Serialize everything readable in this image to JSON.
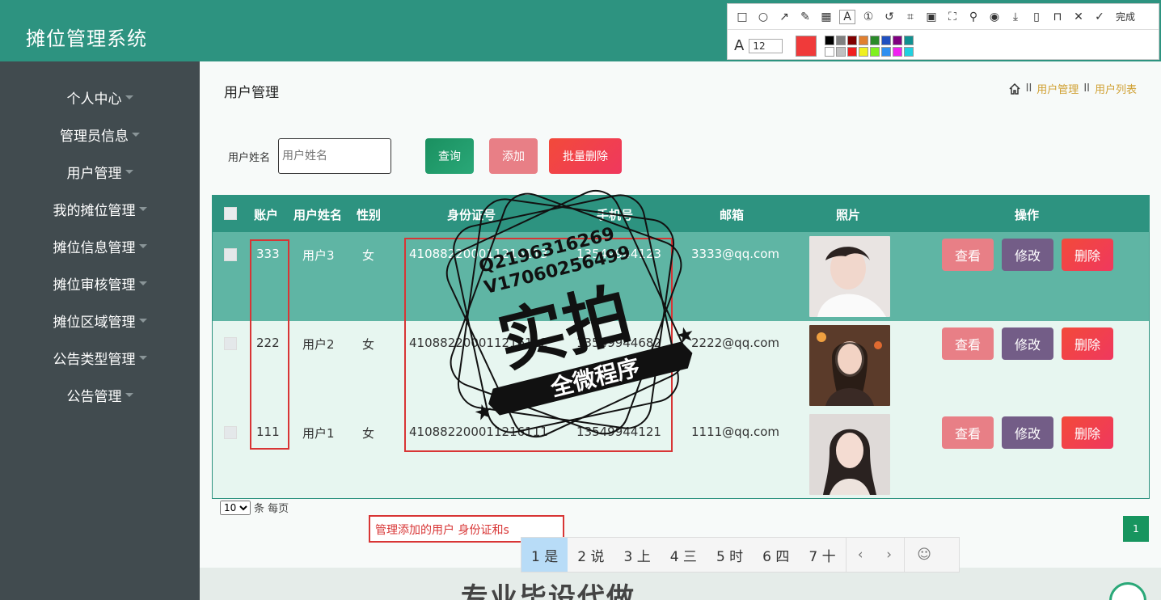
{
  "app": {
    "title": "摊位管理系统"
  },
  "sidebar": {
    "items": [
      {
        "label": "个人中心"
      },
      {
        "label": "管理员信息"
      },
      {
        "label": "用户管理"
      },
      {
        "label": "我的摊位管理"
      },
      {
        "label": "摊位信息管理"
      },
      {
        "label": "摊位审核管理"
      },
      {
        "label": "摊位区域管理"
      },
      {
        "label": "公告类型管理"
      },
      {
        "label": "公告管理"
      }
    ]
  },
  "page": {
    "title": "用户管理",
    "breadcrumb": {
      "sep": "II",
      "item1": "用户管理",
      "item2": "用户列表"
    }
  },
  "search": {
    "label": "用户姓名",
    "placeholder": "用户姓名",
    "query_label": "查询",
    "add_label": "添加",
    "bulk_delete_label": "批量删除"
  },
  "table": {
    "columns": {
      "account": "账户",
      "name": "用户姓名",
      "gender": "性别",
      "idcard": "身份证号",
      "phone": "手机号",
      "email": "邮箱",
      "photo": "照片",
      "actions": "操作"
    },
    "rows": [
      {
        "account": "333",
        "name": "用户3",
        "gender": "女",
        "idcard": "410882200011216113",
        "phone": "13549944123",
        "email": "3333@qq.com"
      },
      {
        "account": "222",
        "name": "用户2",
        "gender": "女",
        "idcard": "410882200011216112",
        "phone": "13549944682",
        "email": "2222@qq.com"
      },
      {
        "account": "111",
        "name": "用户1",
        "gender": "女",
        "idcard": "410882200011216111",
        "phone": "13549944121",
        "email": "1111@qq.com"
      }
    ],
    "action_labels": {
      "view": "查看",
      "edit": "修改",
      "delete": "删除"
    }
  },
  "pagination": {
    "page_size": "10",
    "page_size_suffix": "条 每页",
    "current_page": "1"
  },
  "note": {
    "text": "管理添加的用户 身份证和s"
  },
  "ime": {
    "candidates": [
      {
        "label": "1 是"
      },
      {
        "label": "2 说"
      },
      {
        "label": "3 上"
      },
      {
        "label": "4 三"
      },
      {
        "label": "5 时"
      },
      {
        "label": "6 四"
      },
      {
        "label": "7 十"
      }
    ],
    "prev": "‹",
    "next": "›",
    "emoji": "☺"
  },
  "annotation_toolbar": {
    "font_size": "12",
    "done_label": "完成"
  },
  "watermark": {
    "line1": "Q2196316269",
    "line2": "V17060256499",
    "big": "实拍",
    "banner": "全微程序"
  },
  "bottom_text": "专业毕设代做",
  "colors": {
    "header": "#2d9380",
    "sidebar": "#414b4f",
    "selected_row": "#5fb5a4",
    "annotation_red": "#d83535"
  }
}
